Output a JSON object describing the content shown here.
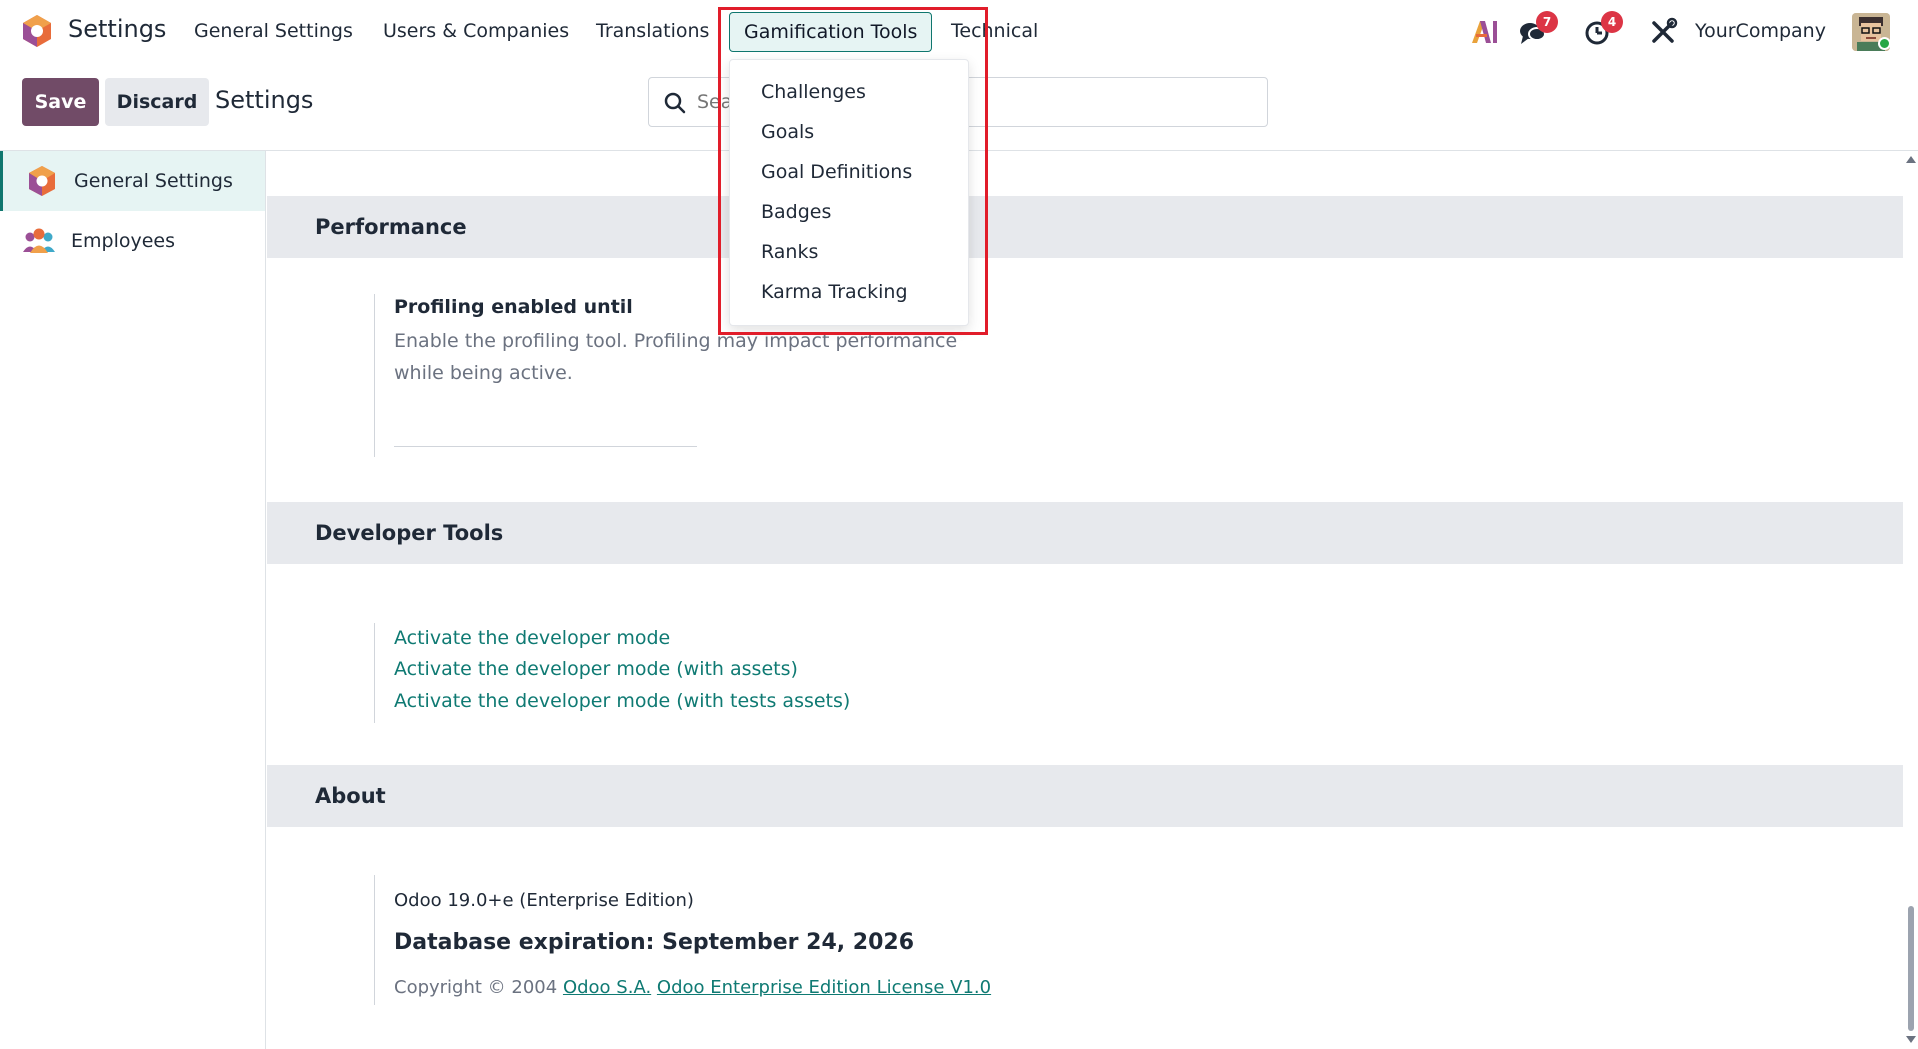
{
  "navbar": {
    "app_title": "Settings",
    "menu": [
      {
        "label": "General Settings"
      },
      {
        "label": "Users & Companies"
      },
      {
        "label": "Translations"
      },
      {
        "label": "Gamification Tools"
      },
      {
        "label": "Technical"
      }
    ],
    "active_menu": "Gamification Tools",
    "ai_icon_label": "AI",
    "messages_count": "7",
    "activities_count": "4",
    "company": "YourCompany"
  },
  "control_panel": {
    "save_label": "Save",
    "discard_label": "Discard",
    "title": "Settings",
    "search_placeholder": "Search..."
  },
  "sidebar": {
    "items": [
      {
        "label": "General Settings",
        "active": true
      },
      {
        "label": "Employees",
        "active": false
      }
    ]
  },
  "performance": {
    "heading": "Performance",
    "profiling_title": "Profiling enabled until",
    "profiling_desc": "Enable the profiling tool. Profiling may impact performance while being active."
  },
  "developer_tools": {
    "heading": "Developer Tools",
    "links": [
      "Activate the developer mode",
      "Activate the developer mode (with assets)",
      "Activate the developer mode (with tests assets)"
    ]
  },
  "about": {
    "heading": "About",
    "version": "Odoo 19.0+e (Enterprise Edition)",
    "expiration": "Database expiration: September 24, 2026",
    "copyright_prefix": "Copyright © 2004",
    "company_link": "Odoo S.A.",
    "license_link": "Odoo Enterprise Edition License V1.0"
  },
  "dropdown": {
    "items": [
      "Challenges",
      "Goals",
      "Goal Definitions",
      "Badges",
      "Ranks",
      "Karma Tracking"
    ]
  },
  "colors": {
    "brand_primary": "#714b67",
    "link_teal": "#0f7a73",
    "badge_red": "#dc3545",
    "highlight_red": "#e11d2a",
    "section_bg": "#e7e9ed"
  }
}
